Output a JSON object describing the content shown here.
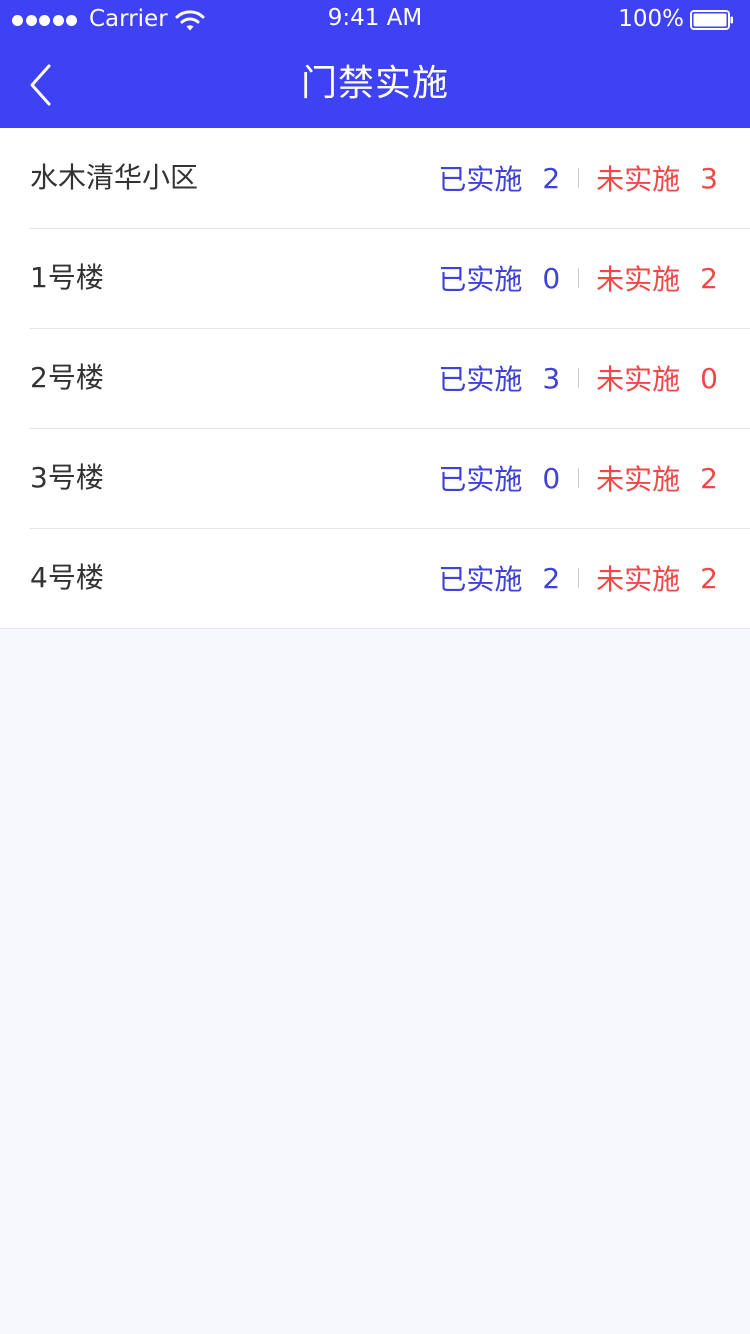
{
  "status_bar": {
    "carrier": "Carrier",
    "time": "9:41 AM",
    "battery": "100%"
  },
  "nav": {
    "title": "门禁实施",
    "back_icon": "chevron-left-icon"
  },
  "colors": {
    "header": "#3f41f5",
    "implemented": "#3f41d9",
    "not_implemented": "#f04848",
    "page_background": "#f7f8fc"
  },
  "list": {
    "items": [
      {
        "name": "水木清华小区",
        "implemented_label": "已实施",
        "implemented_count": "2",
        "not_implemented_label": "未实施",
        "not_implemented_count": "3"
      },
      {
        "name": "1号楼",
        "implemented_label": "已实施",
        "implemented_count": "0",
        "not_implemented_label": "未实施",
        "not_implemented_count": "2"
      },
      {
        "name": "2号楼",
        "implemented_label": "已实施",
        "implemented_count": "3",
        "not_implemented_label": "未实施",
        "not_implemented_count": "0"
      },
      {
        "name": "3号楼",
        "implemented_label": "已实施",
        "implemented_count": "0",
        "not_implemented_label": "未实施",
        "not_implemented_count": "2"
      },
      {
        "name": "4号楼",
        "implemented_label": "已实施",
        "implemented_count": "2",
        "not_implemented_label": "未实施",
        "not_implemented_count": "2"
      }
    ]
  }
}
